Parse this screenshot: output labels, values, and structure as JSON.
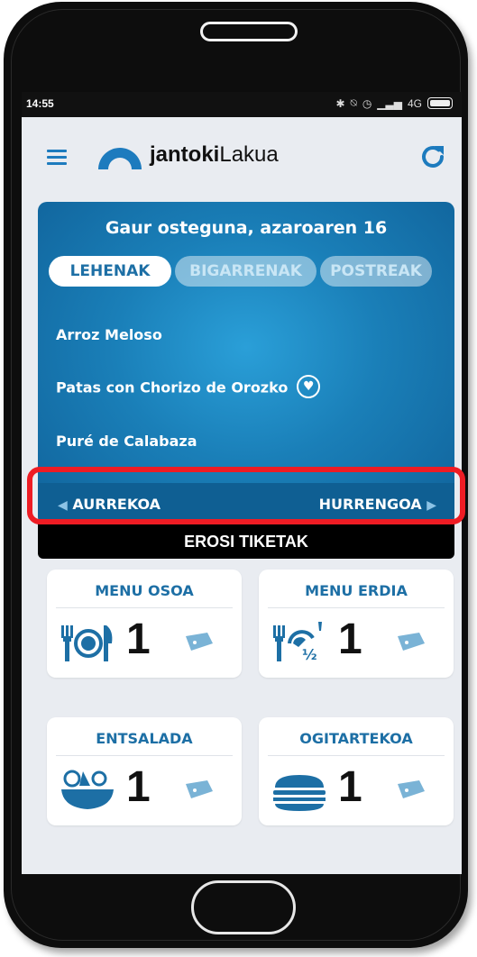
{
  "status": {
    "time": "14:55",
    "network": "4G"
  },
  "app": {
    "brand_bold": "jantoki",
    "brand_light": "Lakua"
  },
  "menu": {
    "date": "Gaur osteguna, azaroaren 16",
    "tabs": [
      {
        "label": "LEHENAK",
        "active": true
      },
      {
        "label": "BIGARRENAK",
        "active": false
      },
      {
        "label": "POSTREAK",
        "active": false
      }
    ],
    "dishes": [
      {
        "name": "Arroz Meloso",
        "favorite": false
      },
      {
        "name": "Patas con Chorizo de Orozko",
        "favorite": true
      },
      {
        "name": "Puré de Calabaza",
        "favorite": false
      }
    ],
    "prev_label": "AURREKOA",
    "next_label": "HURRENGOA"
  },
  "buy_label": "EROSI TIKETAK",
  "tickets": [
    {
      "title": "MENU OSOA",
      "count": "1",
      "icon": "plate-cutlery-icon"
    },
    {
      "title": "MENU ERDIA",
      "count": "1",
      "icon": "half-menu-icon"
    },
    {
      "title": "ENTSALADA",
      "count": "1",
      "icon": "salad-bowl-icon"
    },
    {
      "title": "OGITARTEKOA",
      "count": "1",
      "icon": "sandwich-icon"
    }
  ],
  "colors": {
    "primary": "#1d6fa5",
    "accent_blue": "#1d7bbe",
    "highlight": "#ee1c24"
  }
}
